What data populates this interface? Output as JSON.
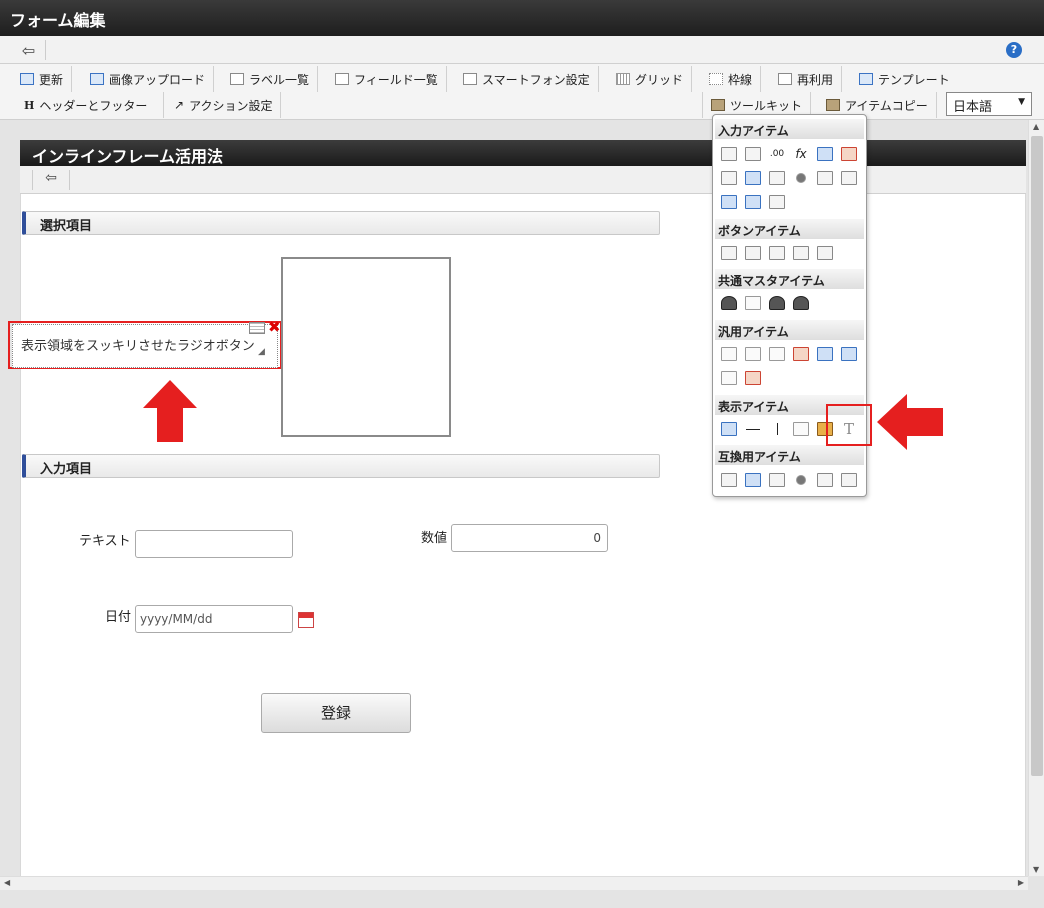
{
  "window": {
    "title": "フォーム編集"
  },
  "toolbar": {
    "row1": [
      "更新",
      "画像アップロード",
      "ラベル一覧",
      "フィールド一覧",
      "スマートフォン設定",
      "グリッド",
      "枠線",
      "再利用",
      "テンプレート"
    ],
    "row2_left": [
      "ヘッダーとフッター",
      "アクション設定"
    ],
    "row2_right": [
      "ツールキット",
      "アイテムコピー"
    ],
    "header_icon_letter": "H",
    "language": "日本語"
  },
  "form": {
    "title": "インラインフレーム活用法",
    "section_select": "選択項目",
    "radio_text": "表示領域をスッキリさせたラジオボタン",
    "section_input": "入力項目",
    "text_label": "テキスト",
    "number_label": "数値",
    "number_value": "0",
    "date_label": "日付",
    "date_placeholder": "yyyy/MM/dd",
    "submit_label": "登録"
  },
  "palette": {
    "groups": [
      "入力アイテム",
      "ボタンアイテム",
      "共通マスタアイテム",
      "汎用アイテム",
      "表示アイテム",
      "互換用アイテム"
    ],
    "fx_label": "fx",
    "num_label": ".00",
    "text_item_glyph": "T"
  },
  "colors": {
    "highlight": "#e51f1f",
    "section_accent": "#2f4e9a",
    "title_bar": "#1e1e1e"
  }
}
